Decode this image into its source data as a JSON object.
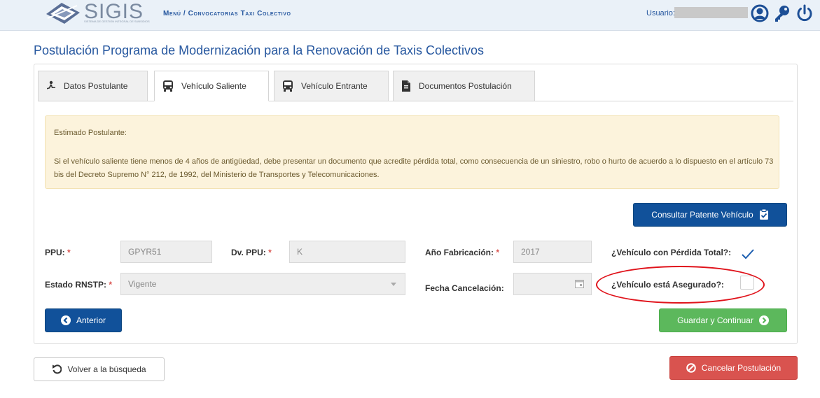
{
  "header": {
    "logo_text": "SIGIS",
    "logo_subtitle": "SISTEMA DE GESTIÓN INTEGRAL DE SUBSIDIOS",
    "breadcrumb": "Menú / Convocatorias Taxi Colectivo",
    "user_label": "Usuario: V"
  },
  "page": {
    "title": "Postulación Programa de Modernización para la Renovación de Taxis Colectivos"
  },
  "tabs": [
    {
      "label": "Datos Postulante",
      "active": false
    },
    {
      "label": "Vehículo Saliente",
      "active": true
    },
    {
      "label": "Vehículo Entrante",
      "active": false
    },
    {
      "label": "Documentos Postulación",
      "active": false
    }
  ],
  "alert": {
    "greeting": "Estimado Postulante:",
    "message": "Si el vehículo saliente tiene menos de 4 años de antigüedad, debe presentar un documento que acredite pérdida total, como consecuencia de un siniestro, robo o hurto de acuerdo a lo dispuesto en el artículo 73 bis del Decreto Supremo N° 212, de 1992, del Ministerio de Transportes y Telecomunicaciones."
  },
  "buttons": {
    "consultar": "Consultar Patente Vehículo",
    "anterior": "Anterior",
    "guardar": "Guardar y Continuar",
    "volver": "Volver a la búsqueda",
    "cancelar": "Cancelar Postulación"
  },
  "form": {
    "ppu_label": "PPU:",
    "ppu_value": "GPYR51",
    "dv_label": "Dv. PPU:",
    "dv_value": "K",
    "anio_label": "Año Fabricación:",
    "anio_value": "2017",
    "perdida_label": "¿Vehículo con Pérdida Total?:",
    "perdida_checked": true,
    "estado_label": "Estado RNSTP:",
    "estado_value": "Vigente",
    "fecha_label": "Fecha Cancelación:",
    "fecha_value": "",
    "asegurado_label": "¿Vehículo está Asegurado?:",
    "asegurado_checked": false,
    "required_mark": "*"
  },
  "colors": {
    "primary": "#11519a",
    "success": "#5cb85c",
    "danger": "#d9534f",
    "alert_bg": "#fcf3dc",
    "annotation": "#e0131b"
  }
}
